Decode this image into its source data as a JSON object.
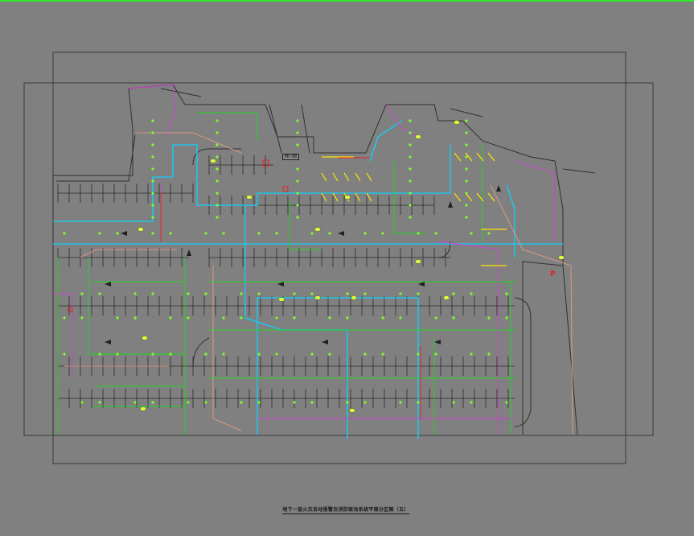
{
  "drawing": {
    "caption": "地下一层火灾自动报警及消防联动系统平面分区图（五）",
    "room_tag": "PD-08",
    "parking_mark": "P"
  },
  "colors": {
    "background": "#808080",
    "frame": "#3a3a3a",
    "wall": "#303030",
    "cable_cyan": "#21c4e8",
    "cable_green": "#1fd61f",
    "cable_magenta": "#d63ad6",
    "cable_salmon": "#f0a080",
    "detector": "#7cff2a",
    "accent_yellow": "#ffe600",
    "accent_red": "#e8202a",
    "top_accent": "#2ee82e"
  }
}
